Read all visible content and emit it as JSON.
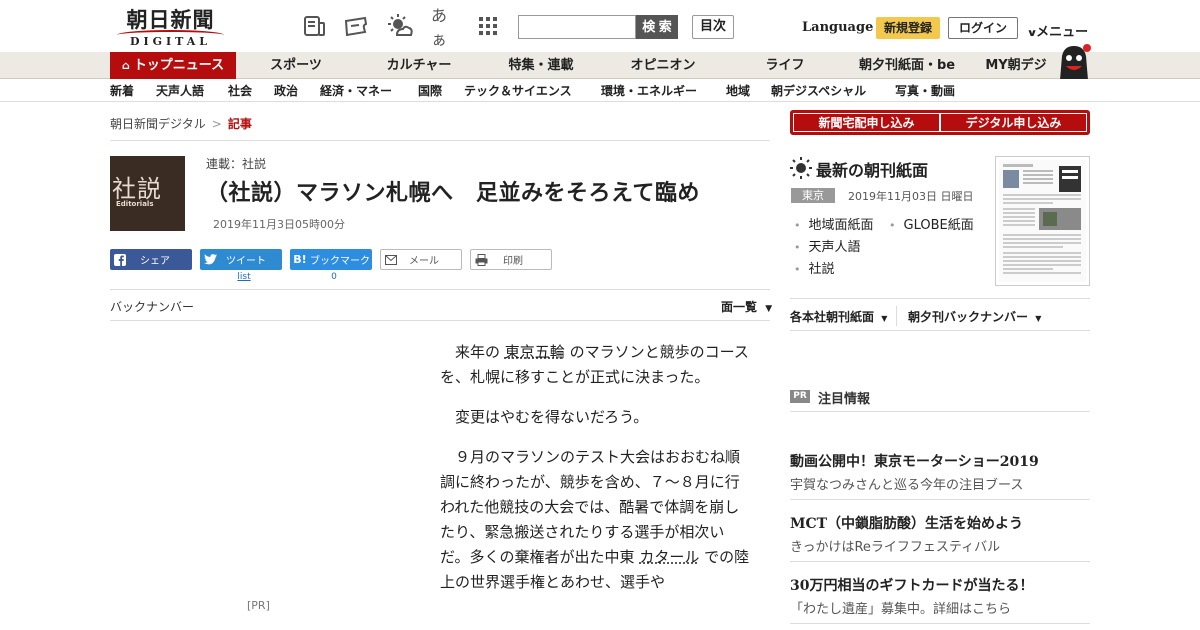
{
  "header": {
    "logo_main": "朝日新聞",
    "logo_sub": "DIGITAL",
    "aa_label": "あぁ",
    "search_btn": "検 索",
    "toc_btn": "目次",
    "language": "Language",
    "register": "新規登録",
    "login": "ログイン",
    "menu": "メニュー"
  },
  "nav_primary": [
    "トップニュース",
    "スポーツ",
    "カルチャー",
    "特集・連載",
    "オピニオン",
    "ライフ",
    "朝夕刊紙面・be",
    "MY朝デジ"
  ],
  "nav_secondary": [
    "新着",
    "天声人語",
    "社会",
    "政治",
    "経済・マネー",
    "国際",
    "テック＆サイエンス",
    "環境・エネルギー",
    "地域",
    "朝デジスペシャル",
    "写真・動画"
  ],
  "breadcrumb": {
    "home": "朝日新聞デジタル",
    "sep": ">",
    "current": "記事"
  },
  "article": {
    "thumb_kanji": "社説",
    "thumb_en": "Editorials",
    "series": "連載：社説",
    "title": "（社説）マラソン札幌へ　足並みをそろえて臨め",
    "date": "2019年11月3日05時00分",
    "share": {
      "facebook": "シェア",
      "twitter": "ツイート",
      "hatena": "ブックマーク",
      "mail": "メール",
      "print": "印刷",
      "twitter_count": "list",
      "hatena_count": "0"
    },
    "back_number": "バックナンバー",
    "page_list": "面一覧",
    "pr_label": "[PR]",
    "p1_a": "来年の",
    "p1_link": "東京五輪",
    "p1_b": "のマラソンと競歩のコースを、札幌に移すことが正式に決まった。",
    "p2": "変更はやむを得ないだろう。",
    "p3_a": "９月のマラソンのテスト大会はおおむね順調に終わったが、競歩を含め、７～８月に行われた他競技の大会では、酷暑で体調を崩したり、緊急搬送されたりする選手が相次いだ。多くの棄権者が出た中東",
    "p3_link": "カタール",
    "p3_b": "での陸上の世界選手権とあわせ、選手や"
  },
  "sidebar": {
    "sub_newspaper": "新聞宅配申し込み",
    "sub_digital": "デジタル申し込み",
    "latest_title": "最新の朝刊紙面",
    "region": "東京",
    "paper_date": "2019年11月03日 日曜日",
    "paper_links": [
      "地域面紙面",
      "GLOBE紙面",
      "天声人語",
      "社説"
    ],
    "honsha": "各本社朝刊紙面",
    "yukan": "朝夕刊バックナンバー",
    "pr_tag": "PR",
    "attention": "注目情報",
    "pr_items": [
      {
        "title": "動画公開中！東京モーターショー2019",
        "sub": "宇賀なつみさんと巡る今年の注目ブース"
      },
      {
        "title": "MCT（中鎖脂肪酸）生活を始めよう",
        "sub": "きっかけはReライフフェスティバル"
      },
      {
        "title": "30万円相当のギフトカードが当たる！",
        "sub": "「わたし遺産」募集中。詳細はこちら"
      }
    ]
  },
  "colors": {
    "brand_red": "#b50d0d",
    "nav_bg": "#eceae3",
    "register_yellow": "#f2c94c"
  }
}
